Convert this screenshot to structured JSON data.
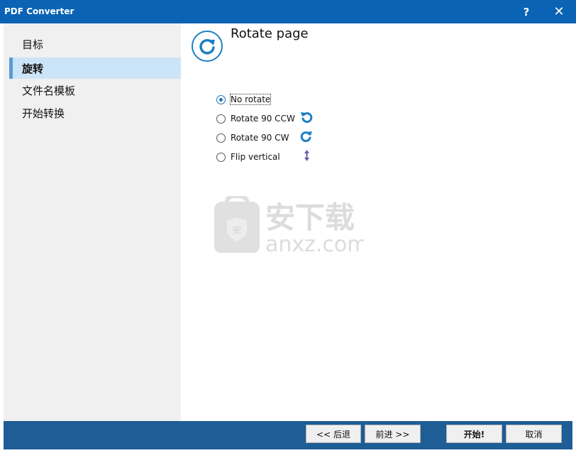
{
  "window": {
    "title": "PDF Converter",
    "help_label": "?",
    "close_label": "✕"
  },
  "sidebar": {
    "items": [
      {
        "label": "目标",
        "active": false
      },
      {
        "label": "旋转",
        "active": true
      },
      {
        "label": "文件名模板",
        "active": false
      },
      {
        "label": "开始转换",
        "active": false
      }
    ]
  },
  "page": {
    "title": "Rotate page",
    "icon": "rotate-page-icon"
  },
  "options": [
    {
      "label": "No rotate",
      "checked": true,
      "icon": null
    },
    {
      "label": "Rotate 90 CCW",
      "checked": false,
      "icon": "rotate-ccw-icon"
    },
    {
      "label": "Rotate 90 CW",
      "checked": false,
      "icon": "rotate-cw-icon"
    },
    {
      "label": "Flip vertical",
      "checked": false,
      "icon": "flip-vertical-icon"
    }
  ],
  "watermark": {
    "text_cn": "安下载",
    "text_en": "anxz.com"
  },
  "footer": {
    "back_label": "<< 后退",
    "next_label": "前进 >>",
    "start_label": "开始!",
    "cancel_label": "取消"
  },
  "colors": {
    "titlebar": "#0a63b4",
    "footer": "#1e5d96",
    "accent": "#1e7fc5",
    "active_nav": "#cce4f7"
  }
}
